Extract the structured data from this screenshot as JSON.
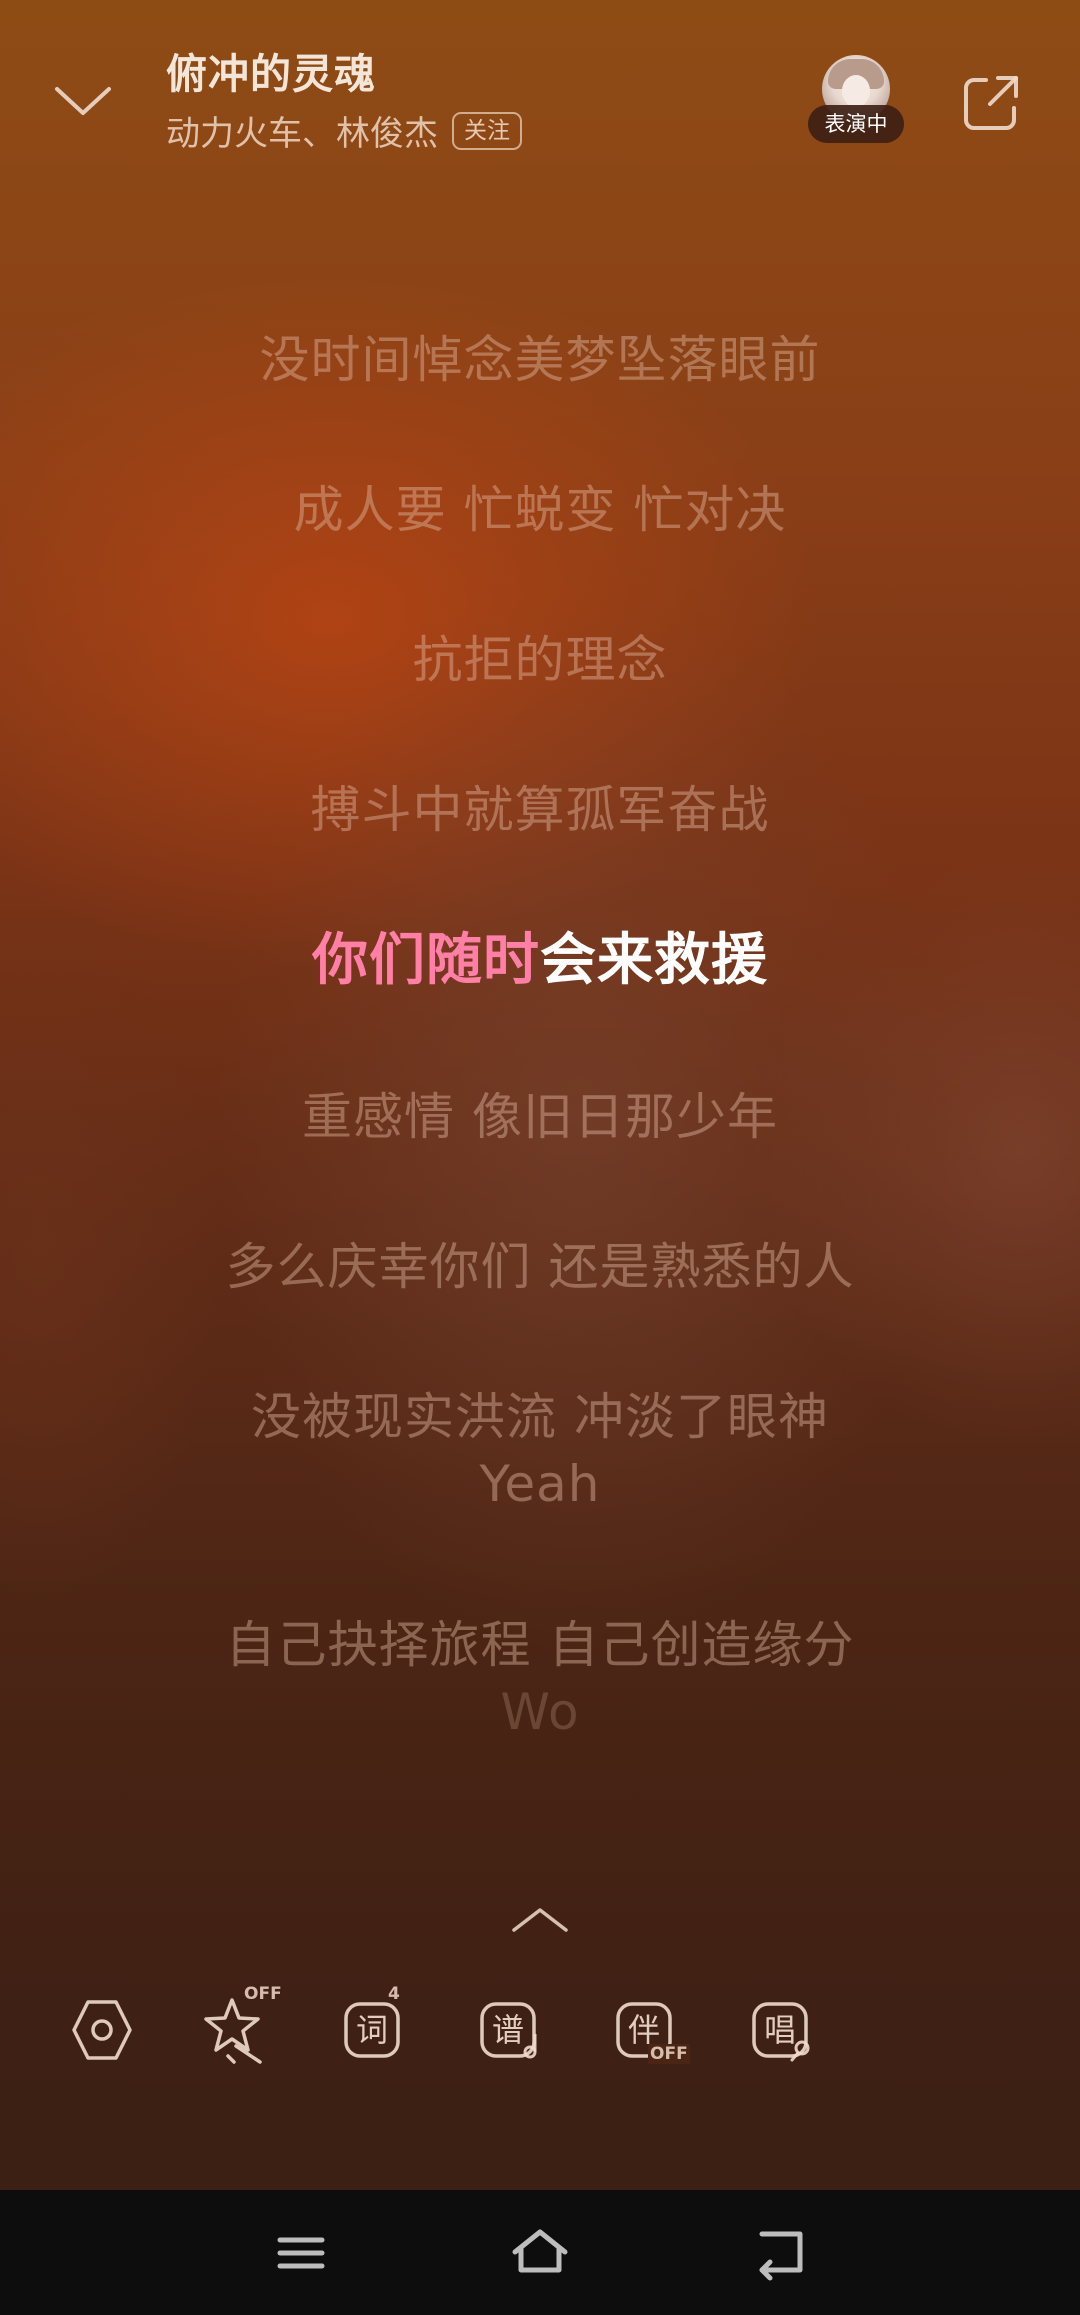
{
  "header": {
    "song_title": "俯冲的灵魂",
    "artists": "动力火车、林俊杰",
    "follow_label": "关注",
    "live_badge": "表演中"
  },
  "lyrics": [
    {
      "text": "没时间悼念美梦坠落眼前",
      "state": "past"
    },
    {
      "text": "成人要 忙蜕变 忙对决",
      "state": "past"
    },
    {
      "text": "抗拒的理念",
      "state": "past"
    },
    {
      "text": "搏斗中就算孤军奋战",
      "state": "past"
    },
    {
      "sung": "你们随时",
      "unsung": "会来救援",
      "state": "current"
    },
    {
      "text": "重感情 像旧日那少年",
      "state": "upcoming"
    },
    {
      "text": "多么庆幸你们 还是熟悉的人",
      "state": "upcoming"
    },
    {
      "text": "没被现实洪流 冲淡了眼神",
      "state": "upcoming"
    },
    {
      "text": "Yeah",
      "state": "upcoming"
    },
    {
      "text": "自己抉择旅程 自己创造缘分",
      "state": "upcoming"
    },
    {
      "text": "Wo",
      "state": "upcoming"
    }
  ],
  "toolbar": {
    "items": [
      {
        "icon": "settings-hexagon-icon"
      },
      {
        "icon": "star-effect-icon",
        "sup": "OFF"
      },
      {
        "icon": "lyrics-icon",
        "glyph": "词",
        "sup": "4"
      },
      {
        "icon": "score-icon",
        "glyph": "谱"
      },
      {
        "icon": "accompaniment-icon",
        "glyph": "伴",
        "sub": "OFF"
      },
      {
        "icon": "sing-icon",
        "glyph": "唱"
      }
    ]
  },
  "colors": {
    "sung_highlight": "#ff7fa6",
    "current_line": "#ffffff",
    "navbar": "#0d0d0d"
  }
}
